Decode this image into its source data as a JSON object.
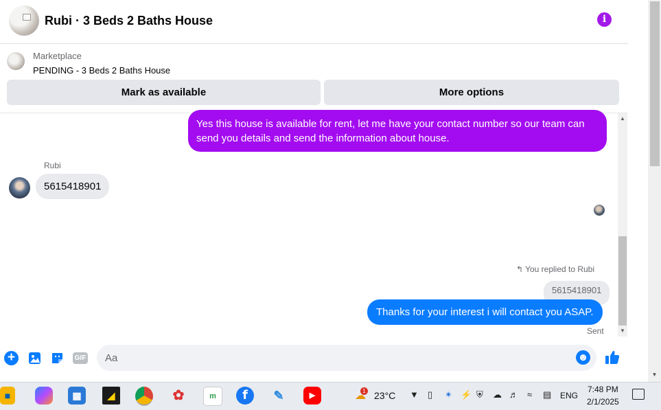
{
  "header": {
    "title": "Rubi · 3 Beds 2 Baths House",
    "info_icon": "info-icon"
  },
  "marketplace": {
    "label": "Marketplace",
    "status": "PENDING - 3 Beds 2 Baths House",
    "mark_available_label": "Mark as available",
    "more_options_label": "More options"
  },
  "messages": {
    "outgoing_1": "Yes this house is  available for rent, let me have your contact number so our team can send you details and send the information about house.",
    "sender_name": "Rubi",
    "incoming_1": "5615418901",
    "reply_note": "You replied to Rubi",
    "quoted_text": "5615418901",
    "outgoing_2": "Thanks for your interest i will contact you ASAP.",
    "status": "Sent"
  },
  "composer": {
    "placeholder": "Aa",
    "gif_label": "GIF"
  },
  "taskbar": {
    "weather_temp": "23°C",
    "weather_badge": "1",
    "language": "ENG",
    "time": "7:48 PM",
    "date": "2/1/2025",
    "m_badge": "m"
  },
  "colors": {
    "accent_purple": "#a30cf0",
    "messenger_blue": "#0a7cff",
    "button_gray": "#e4e6eb"
  }
}
